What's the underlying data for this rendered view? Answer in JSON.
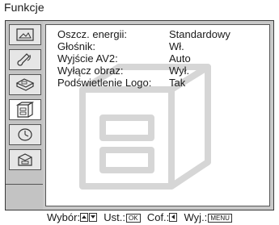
{
  "title": "Funkcje",
  "tabs": [
    {
      "icon": "picture-icon",
      "active": false
    },
    {
      "icon": "sound-icon",
      "active": false
    },
    {
      "icon": "screen-control-icon",
      "active": false
    },
    {
      "icon": "features-icon",
      "active": true
    },
    {
      "icon": "timer-icon",
      "active": false
    },
    {
      "icon": "setup-icon",
      "active": false
    }
  ],
  "settings": [
    {
      "label": "Oszcz. energii:",
      "value": "Standardowy"
    },
    {
      "label": "Głośnik:",
      "value": "Wł."
    },
    {
      "label": "Wyjście AV2:",
      "value": "Auto"
    },
    {
      "label": "Wyłącz obraz:",
      "value": "Wył."
    },
    {
      "label": "Podświetlenie Logo:",
      "value": "Tak"
    }
  ],
  "footer": {
    "select_label": "Wybór:",
    "set_label": "Ust.:",
    "set_key": "OK",
    "back_label": "Cof.:",
    "exit_label": "Wyj.:",
    "exit_key": "MENU"
  },
  "colors": {
    "frame": "#c9c9c9",
    "panel": "#ffffff",
    "text": "#1a1a1a",
    "watermark": "#d9d9d9"
  }
}
